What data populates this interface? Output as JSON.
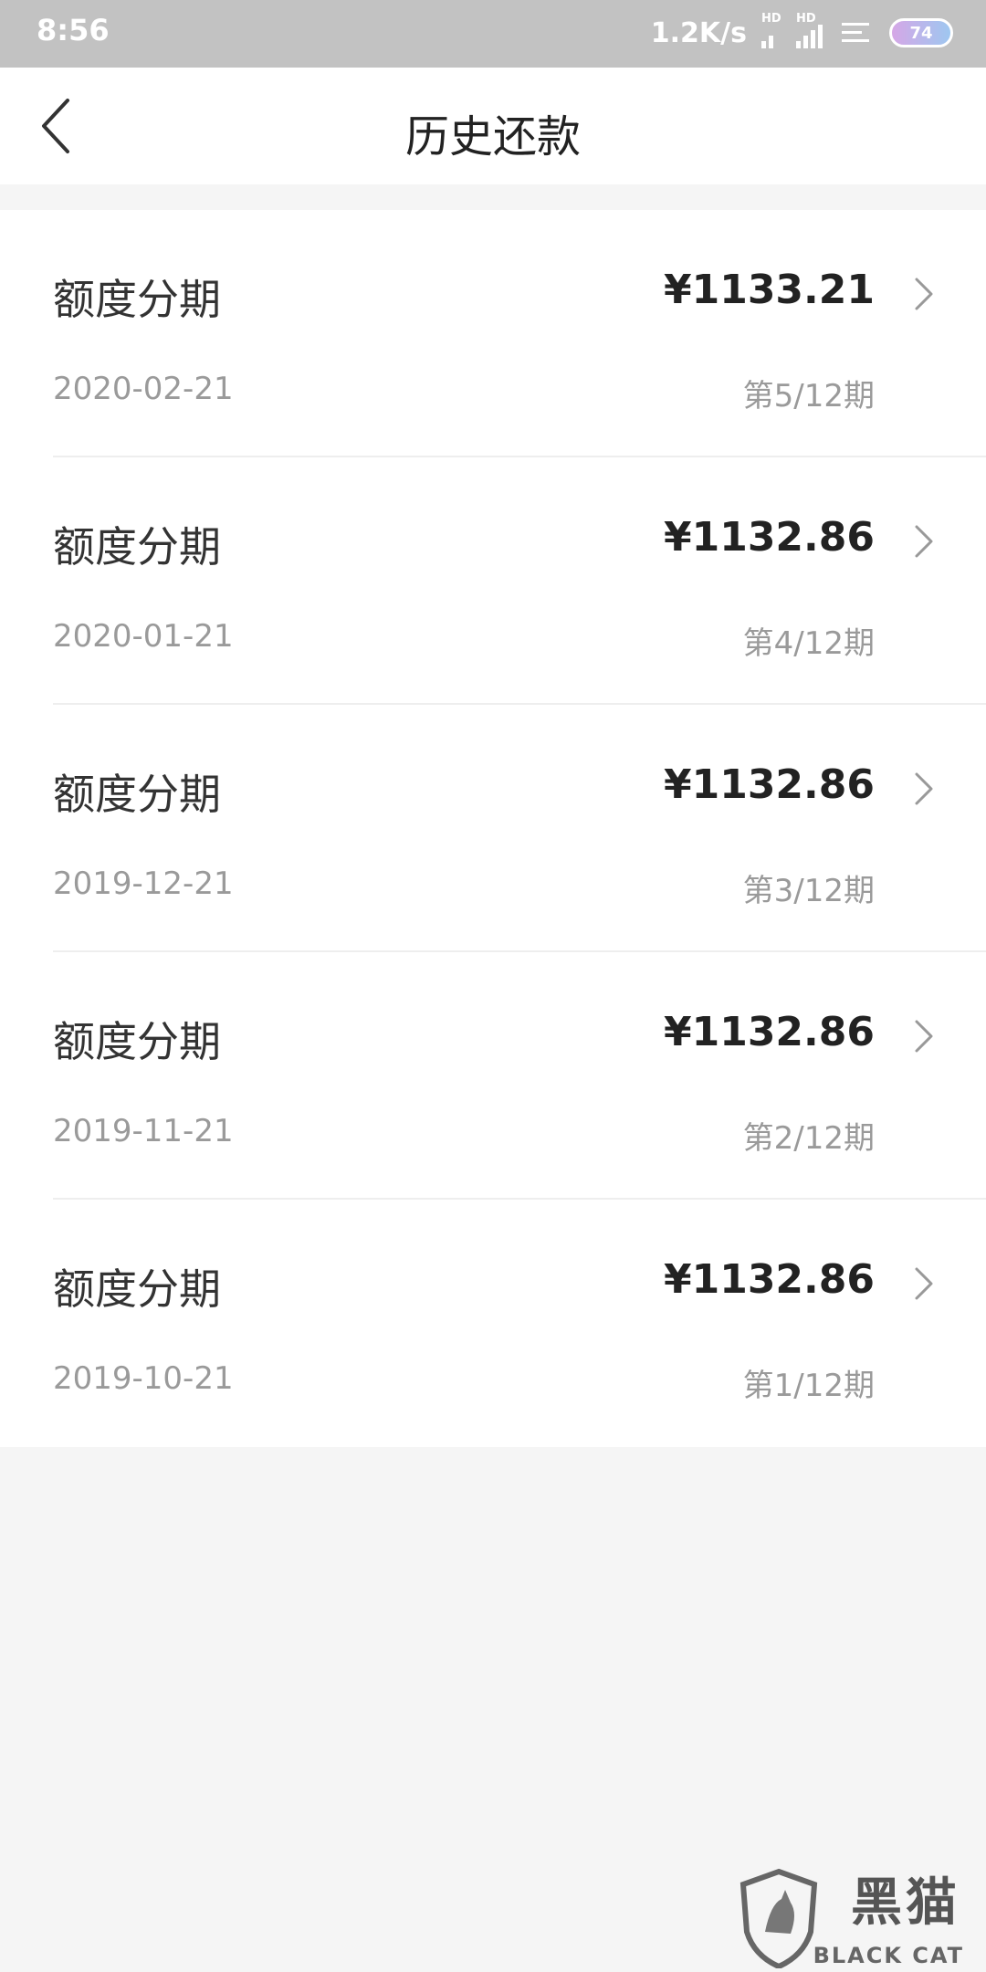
{
  "status_bar": {
    "time": "8:56",
    "network_speed": "1.2K/s",
    "signal_badge_1": "HD",
    "signal_badge_2": "HD",
    "battery": "74"
  },
  "navbar": {
    "title": "历史还款",
    "back_icon": "chevron-left-icon"
  },
  "repayments": [
    {
      "title": "额度分期",
      "amount": "¥1133.21",
      "date": "2020-02-21",
      "period": "第5/12期"
    },
    {
      "title": "额度分期",
      "amount": "¥1132.86",
      "date": "2020-01-21",
      "period": "第4/12期"
    },
    {
      "title": "额度分期",
      "amount": "¥1132.86",
      "date": "2019-12-21",
      "period": "第3/12期"
    },
    {
      "title": "额度分期",
      "amount": "¥1132.86",
      "date": "2019-11-21",
      "period": "第2/12期"
    },
    {
      "title": "额度分期",
      "amount": "¥1132.86",
      "date": "2019-10-21",
      "period": "第1/12期"
    }
  ],
  "watermark": {
    "text": "黑猫",
    "sub": "BLACK CAT"
  },
  "colors": {
    "status_bar_bg": "#c2c2c2",
    "page_bg": "#f5f5f5",
    "card_bg": "#ffffff",
    "primary_text": "#333333",
    "secondary_text": "#9a9a9a"
  }
}
